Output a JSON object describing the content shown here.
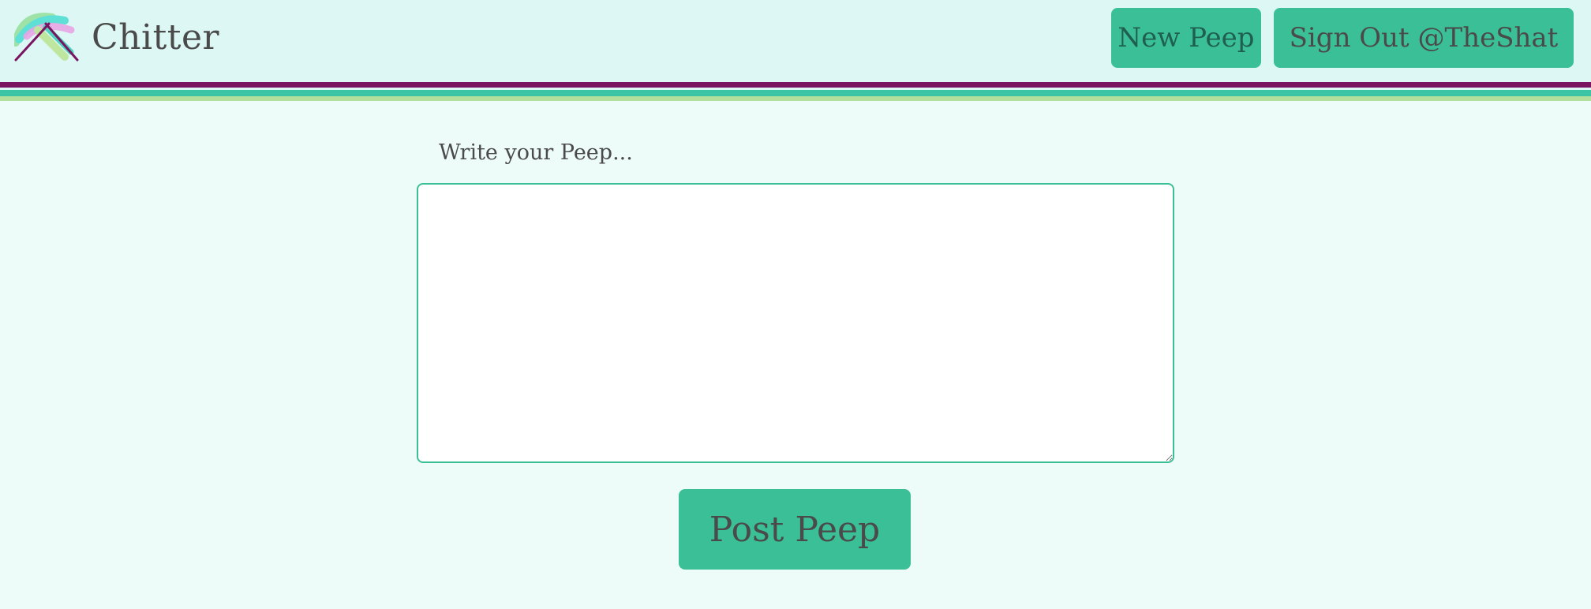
{
  "header": {
    "brand_name": "Chitter",
    "new_peep_label": "New Peep",
    "sign_out_label": "Sign Out @TheShat"
  },
  "compose": {
    "label": "Write your Peep...",
    "textarea_value": "",
    "post_label": "Post Peep"
  },
  "icons": {
    "logo": "chitter-logo"
  },
  "colors": {
    "page_background": "#edfcf8",
    "header_background": "#ddf8f4",
    "button": "#3bbf96",
    "stripe_purple": "#7a1460",
    "stripe_teal": "#3cc4a4",
    "stripe_green": "#b2e09c",
    "text": "#4a4a4a"
  }
}
